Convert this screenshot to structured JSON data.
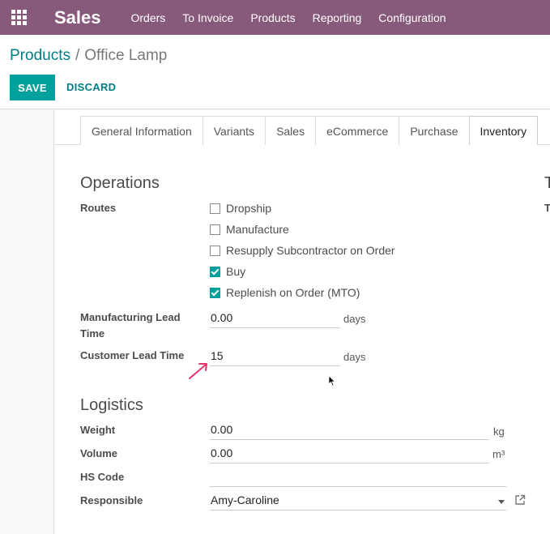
{
  "navbar": {
    "app_name": "Sales",
    "menu": [
      "Orders",
      "To Invoice",
      "Products",
      "Reporting",
      "Configuration"
    ]
  },
  "breadcrumb": {
    "parent": "Products",
    "separator": "/",
    "current": "Office Lamp"
  },
  "buttons": {
    "save": "SAVE",
    "discard": "DISCARD"
  },
  "tabs": [
    "General Information",
    "Variants",
    "Sales",
    "eCommerce",
    "Purchase",
    "Inventory"
  ],
  "active_tab": "Inventory",
  "operations": {
    "title": "Operations",
    "routes_label": "Routes",
    "routes": [
      {
        "label": "Dropship",
        "checked": false
      },
      {
        "label": "Manufacture",
        "checked": false
      },
      {
        "label": "Resupply Subcontractor on Order",
        "checked": false
      },
      {
        "label": "Buy",
        "checked": true
      },
      {
        "label": "Replenish on Order (MTO)",
        "checked": true
      }
    ],
    "manufacturing_lead_time": {
      "label_line1": "Manufacturing Lead",
      "label_line2": "Time",
      "value": "0.00",
      "unit": "days"
    },
    "customer_lead_time": {
      "label": "Customer Lead Time",
      "value": "15",
      "unit": "days"
    }
  },
  "logistics": {
    "title": "Logistics",
    "weight": {
      "label": "Weight",
      "value": "0.00",
      "unit": "kg"
    },
    "volume": {
      "label": "Volume",
      "value": "0.00",
      "unit": "m³"
    },
    "hs_code": {
      "label": "HS Code",
      "value": ""
    },
    "responsible": {
      "label": "Responsible",
      "value": "Amy-Caroline"
    }
  },
  "right_column": {
    "title_fragment": "T",
    "label_fragment": "T"
  },
  "colors": {
    "brand": "#875a7b",
    "accent": "#00a09d",
    "link": "#017e84",
    "arrow": "#e8336d"
  },
  "icons": {
    "apps": "apps-grid-icon",
    "external": "external-link-icon",
    "caret": "chevron-down-icon"
  }
}
